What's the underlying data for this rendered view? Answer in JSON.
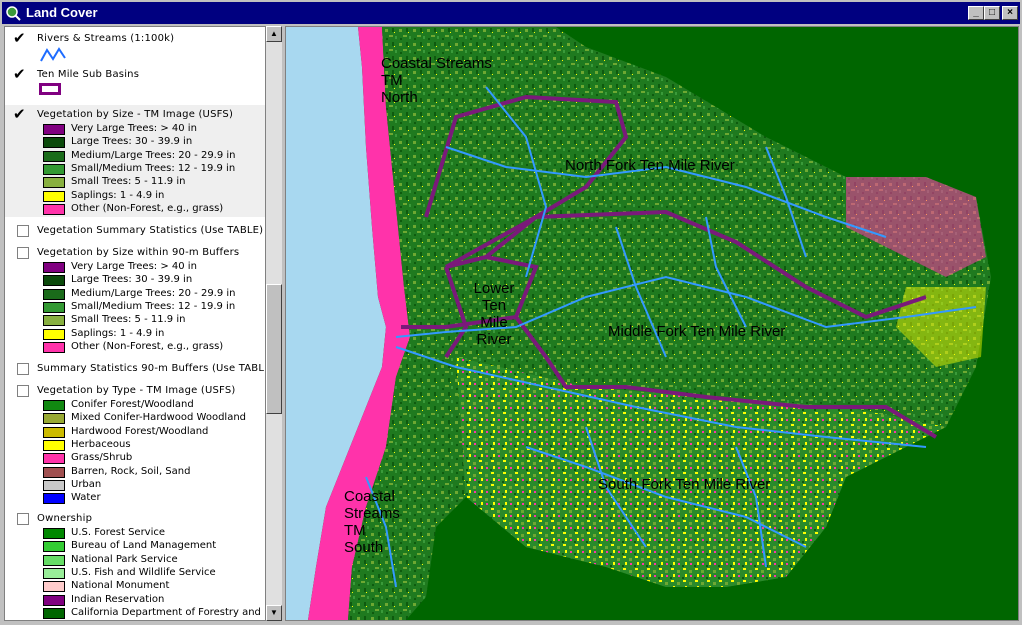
{
  "window": {
    "title": "Land Cover",
    "buttons": {
      "minimize": "_",
      "maximize": "□",
      "close": "×"
    }
  },
  "legend": {
    "layers": [
      {
        "name": "Rivers & Streams (1:100k)",
        "checked": true,
        "symbol": "river-line-icon"
      },
      {
        "name": "Ten Mile Sub Basins",
        "checked": true,
        "symbol": "basin-polygon-icon"
      },
      {
        "name": "Vegetation by Size - TM Image (USFS)",
        "checked": true,
        "classes": [
          {
            "color": "#800080",
            "label": "Very Large Trees: > 40  in"
          },
          {
            "color": "#0b4a0b",
            "label": "Large Trees: 30 - 39.9 in"
          },
          {
            "color": "#1a6b1a",
            "label": "Medium/Large Trees: 20 - 29.9 in"
          },
          {
            "color": "#339933",
            "label": "Small/Medium Trees: 12 - 19.9 in"
          },
          {
            "color": "#88b040",
            "label": "Small Trees: 5 - 11.9 in"
          },
          {
            "color": "#ffff00",
            "label": "Saplings: 1 - 4.9 in"
          },
          {
            "color": "#ff33aa",
            "label": "Other (Non-Forest, e.g., grass)"
          }
        ]
      },
      {
        "name": "Vegetation Summary Statistics (Use TABLE)",
        "checked": false
      },
      {
        "name": "Vegetation by Size within 90-m Buffers",
        "checked": false,
        "classes": [
          {
            "color": "#800080",
            "label": "Very Large Trees: > 40  in"
          },
          {
            "color": "#0b4a0b",
            "label": "Large Trees: 30 - 39.9 in"
          },
          {
            "color": "#1a6b1a",
            "label": "Medium/Large Trees: 20 - 29.9 in"
          },
          {
            "color": "#339933",
            "label": "Small/Medium Trees: 12 - 19.9 in"
          },
          {
            "color": "#88b040",
            "label": "Small Trees: 5 - 11.9 in"
          },
          {
            "color": "#ffff00",
            "label": "Saplings: 1 - 4.9 in"
          },
          {
            "color": "#ff33aa",
            "label": "Other (Non-Forest, e.g., grass)"
          }
        ]
      },
      {
        "name": "Summary Statistics 90-m Buffers (Use TABL",
        "checked": false
      },
      {
        "name": "Vegetation by Type - TM Image (USFS)",
        "checked": false,
        "classes": [
          {
            "color": "#118811",
            "label": "Conifer Forest/Woodland"
          },
          {
            "color": "#99aa33",
            "label": "Mixed Conifer-Hardwood Woodland"
          },
          {
            "color": "#ccbb00",
            "label": "Hardwood Forest/Woodland"
          },
          {
            "color": "#ffff00",
            "label": "Herbaceous"
          },
          {
            "color": "#ff33aa",
            "label": "Grass/Shrub"
          },
          {
            "color": "#a05050",
            "label": "Barren, Rock, Soil, Sand"
          },
          {
            "color": "#c8c8c8",
            "label": "Urban"
          },
          {
            "color": "#0000ff",
            "label": "Water"
          }
        ]
      },
      {
        "name": "Ownership",
        "checked": false,
        "classes": [
          {
            "color": "#008800",
            "label": "U.S. Forest Service"
          },
          {
            "color": "#33cc33",
            "label": "Bureau of Land Management"
          },
          {
            "color": "#66dd66",
            "label": "National Park Service"
          },
          {
            "color": "#99ee99",
            "label": "U.S. Fish and Wildlife Service"
          },
          {
            "color": "#ffcccc",
            "label": "National Monument"
          },
          {
            "color": "#800080",
            "label": "Indian Reservation"
          },
          {
            "color": "#006600",
            "label": "California Department of Forestry and"
          }
        ]
      }
    ]
  },
  "map": {
    "labels": {
      "coastal_north": "Coastal Streams\nTM\nNorth",
      "north_fork": "North Fork Ten Mile River",
      "lower": "Lower\nTen\nMile\nRiver",
      "middle_fork": "Middle Fork Ten Mile River",
      "south_fork": "South Fork Ten Mile River",
      "coastal_south": "Coastal\nStreams\nTM\nSouth"
    },
    "colors": {
      "background": "#006600",
      "ocean": "#a8d8f0",
      "streams": "#3399ff",
      "basin_boundary": "#7a1a7a",
      "forest": "#1f7a1f",
      "mixed": "#6ea832",
      "saplings": "#ffff00",
      "non_forest": "#ff33aa"
    }
  }
}
